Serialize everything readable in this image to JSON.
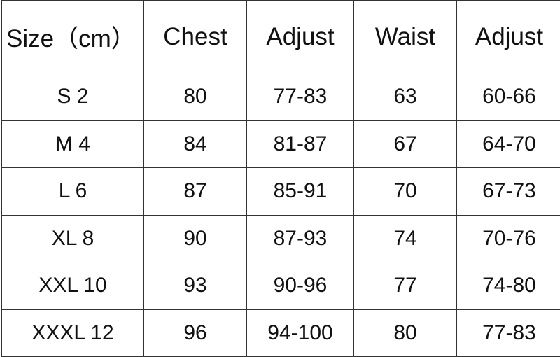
{
  "table": {
    "headers": [
      "Size（cm）",
      "Chest",
      "Adjust",
      "Waist",
      "Adjust"
    ],
    "rows": [
      [
        "S 2",
        "80",
        "77-83",
        "63",
        "60-66"
      ],
      [
        "M 4",
        "84",
        "81-87",
        "67",
        "64-70"
      ],
      [
        "L 6",
        "87",
        "85-91",
        "70",
        "67-73"
      ],
      [
        "XL 8",
        "90",
        "87-93",
        "74",
        "70-76"
      ],
      [
        "XXL 10",
        "93",
        "90-96",
        "77",
        "74-80"
      ],
      [
        "XXXL 12",
        "96",
        "94-100",
        "80",
        "77-83"
      ]
    ]
  }
}
